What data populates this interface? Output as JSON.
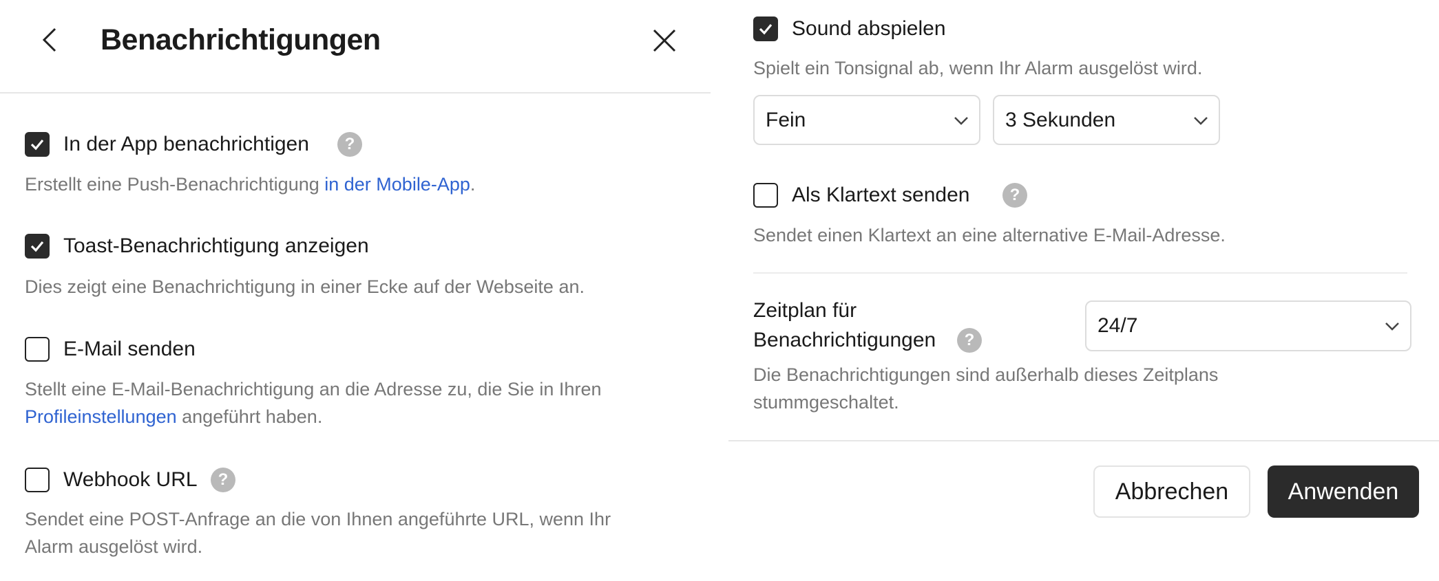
{
  "header": {
    "title": "Benachrichtigungen"
  },
  "icons": {
    "back": "chevron-left-icon",
    "close": "close-icon",
    "check": "check-icon",
    "help": "question-mark-icon",
    "dropdown": "chevron-down-icon"
  },
  "options": {
    "in_app": {
      "label": "In der App benachrichtigen",
      "checked": true,
      "help": "?",
      "desc_prefix": "Erstellt eine Push-Benachrichtigung ",
      "desc_link": "in der Mobile-App",
      "desc_suffix": "."
    },
    "toast": {
      "label": "Toast-Benachrichtigung anzeigen",
      "checked": true,
      "desc": "Dies zeigt eine Benachrichtigung in einer Ecke auf der Webseite an."
    },
    "email": {
      "label": "E-Mail senden",
      "checked": false,
      "desc_line1": "Stellt eine E-Mail-Benachrichtigung an die Adresse zu, die Sie in Ihren",
      "desc_link": "Profileinstellungen",
      "desc_suffix": " angeführt haben."
    },
    "webhook": {
      "label": "Webhook URL",
      "checked": false,
      "help": "?",
      "desc_line1": "Sendet eine POST-Anfrage an die von Ihnen angeführte URL, wenn Ihr",
      "desc_line2": "Alarm ausgelöst wird."
    },
    "sound": {
      "label": "Sound abspielen",
      "checked": true,
      "desc": "Spielt ein Tonsignal ab, wenn Ihr Alarm ausgelöst wird.",
      "sound_select": "Fein",
      "duration_select": "3 Sekunden"
    },
    "plaintext": {
      "label": "Als Klartext senden",
      "checked": false,
      "help": "?",
      "desc": "Sendet einen Klartext an eine alternative E-Mail-Adresse."
    }
  },
  "schedule": {
    "label_line1": "Zeitplan für",
    "label_line2": "Benachrichtigungen",
    "help": "?",
    "value": "24/7",
    "desc_line1": "Die Benachrichtigungen sind außerhalb dieses Zeitplans",
    "desc_line2": "stummgeschaltet."
  },
  "footer": {
    "cancel": "Abbrechen",
    "apply": "Anwenden"
  },
  "colors": {
    "link": "#2f63d1",
    "checkbox_checked": "#2b2b2b",
    "primary_button": "#2b2b2b",
    "help_icon": "#b9b9b9",
    "description_text": "#777777"
  }
}
